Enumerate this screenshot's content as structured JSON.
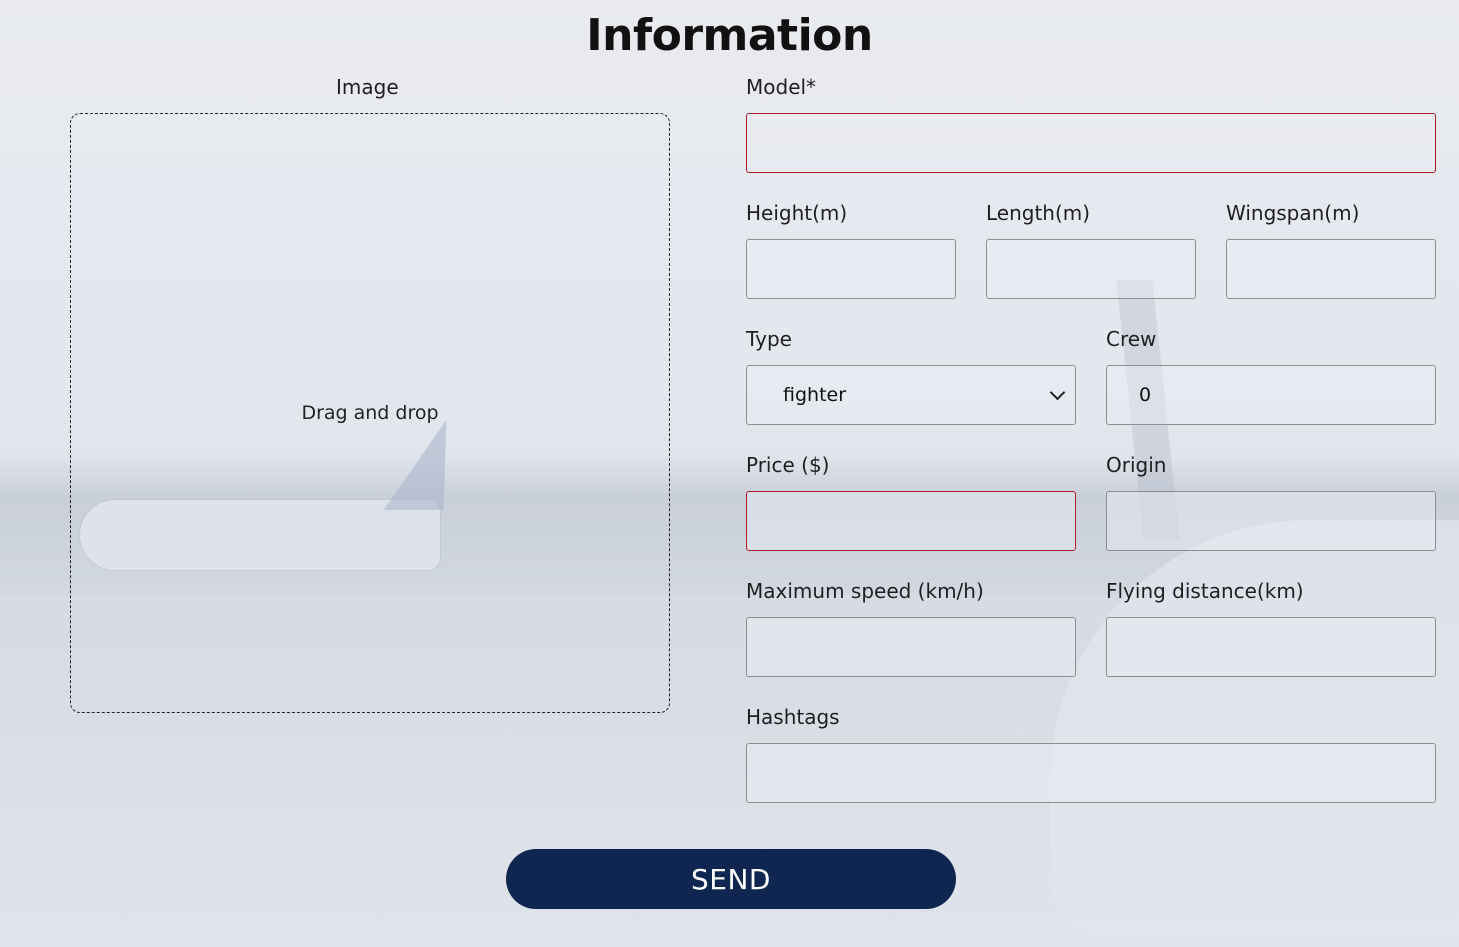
{
  "page": {
    "title": "Information"
  },
  "image_section": {
    "label": "Image",
    "dropzone_text": "Drag and drop"
  },
  "form": {
    "model": {
      "label": "Model*",
      "value": "",
      "invalid": true
    },
    "height": {
      "label": "Height(m)",
      "value": ""
    },
    "length": {
      "label": "Length(m)",
      "value": ""
    },
    "wingspan": {
      "label": "Wingspan(m)",
      "value": ""
    },
    "type": {
      "label": "Type",
      "selected": "fighter"
    },
    "crew": {
      "label": "Crew",
      "value": "0"
    },
    "price": {
      "label": "Price ($)",
      "value": "",
      "invalid": true
    },
    "origin": {
      "label": "Origin",
      "value": ""
    },
    "max_speed": {
      "label": "Maximum speed (km/h)",
      "value": ""
    },
    "flying_distance": {
      "label": "Flying distance(km)",
      "value": ""
    },
    "hashtags": {
      "label": "Hashtags",
      "value": ""
    }
  },
  "actions": {
    "send_label": "SEND"
  },
  "colors": {
    "primary_button": "#0e2650",
    "invalid_border": "#b01c22",
    "field_border": "#8e8e8e"
  }
}
